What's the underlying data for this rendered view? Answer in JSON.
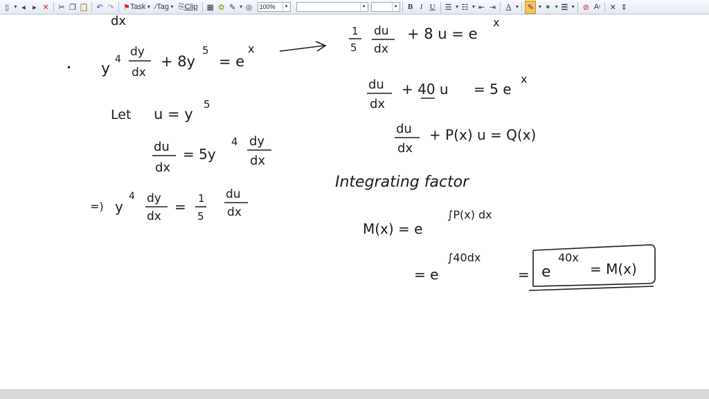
{
  "toolbar": {
    "task_label": "Task",
    "tag_label": "Tag",
    "clip_label": "Clip",
    "zoom_value": "100%",
    "bold_label": "B",
    "italic_label": "I",
    "underline_label": "U",
    "font_color_letter": "A",
    "superscript_label": "A",
    "pen_color": "#f0a030",
    "highlight_color": "#2e8b2e",
    "line_color": "#1a2a5a",
    "icons": [
      "new-page",
      "prev",
      "next",
      "delete",
      "cut",
      "copy",
      "paste",
      "undo",
      "redo",
      "task-flag",
      "tag",
      "clip",
      "table",
      "insert",
      "pen",
      "zoom-tool",
      "bullets",
      "numbering",
      "outdent",
      "indent",
      "font-color",
      "pen",
      "fill",
      "line-style",
      "lasso",
      "text-size",
      "close",
      "space"
    ]
  },
  "notes": {
    "top_left_partial": "dx",
    "eq1": {
      "lhs": "y",
      "lhs_exp": "4",
      "frac_num": "dy",
      "frac_den": "dx",
      "rest": "+ 8y",
      "rest_exp": "5",
      "eq": "= e",
      "rhs_exp": "x",
      "bullet": "•"
    },
    "let_line": {
      "word": "Let",
      "expr": "u = y",
      "exp": "5"
    },
    "deriv": {
      "num": "du",
      "den": "dx",
      "eq": "= 5y",
      "exp": "4",
      "num2": "dy",
      "den2": "dx"
    },
    "implies": {
      "arrow": "=)",
      "lhs": "y",
      "lhs_exp": "4",
      "num": "dy",
      "den": "dx",
      "eq": "=",
      "one": "1",
      "five": "5",
      "num2": "du",
      "den2": "dx"
    },
    "r1": {
      "one": "1",
      "five": "5",
      "num": "du",
      "den": "dx",
      "rest": "+ 8 u = e",
      "exp": "x"
    },
    "r2": {
      "num": "du",
      "den": "dx",
      "rest": "+ 40 u",
      "eq": "= 5 e",
      "exp": "x"
    },
    "r3": {
      "num": "du",
      "den": "dx",
      "rest": "+ P(x) u = Q(x)"
    },
    "r4": {
      "text": "Integrating  factor"
    },
    "r5": {
      "lhs": "M(x) =  e",
      "exp": "∫P(x) dx"
    },
    "r6": {
      "eq": "= e",
      "exp": "∫40dx",
      "eq2": "=",
      "boxed": "e",
      "boxed_exp": "40x",
      "boxed_rest": "= M(x)"
    }
  }
}
